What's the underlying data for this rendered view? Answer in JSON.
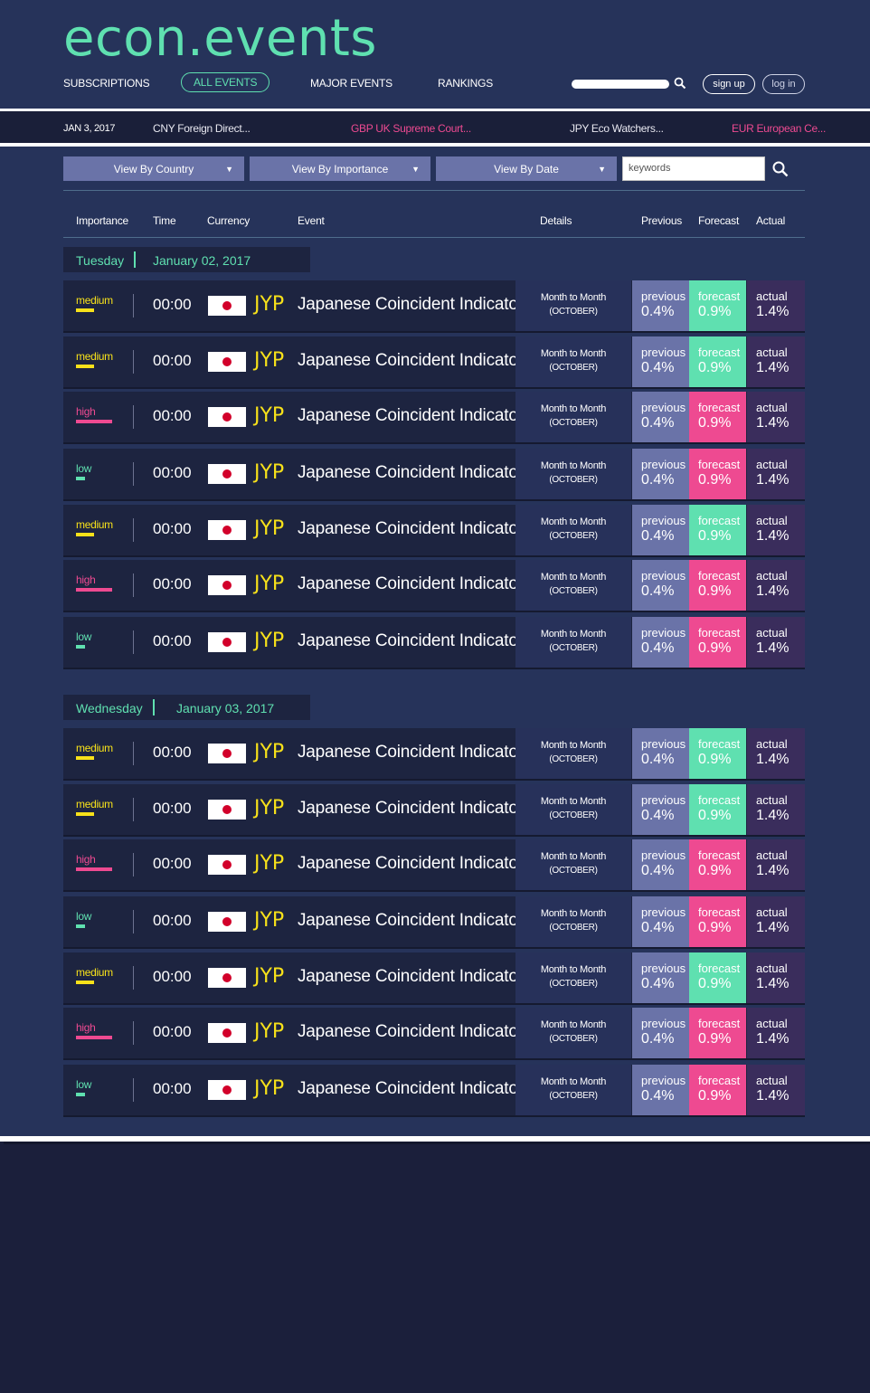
{
  "brand": {
    "logo": "econ.events"
  },
  "nav": {
    "items": [
      "SUBSCRIPTIONS",
      "ALL EVENTS",
      "MAJOR EVENTS",
      "RANKINGS"
    ],
    "active": "ALL EVENTS",
    "signup_label": "sign up",
    "login_label": "log in"
  },
  "ticker": {
    "date": "JAN 3, 2017",
    "items": [
      {
        "text": "CNY Foreign Direct...",
        "color": "#e8e8f0"
      },
      {
        "text": "GBP UK Supreme Court...",
        "color": "#ee4a91"
      },
      {
        "text": "JPY Eco Watchers...",
        "color": "#e8e8f0"
      },
      {
        "text": "EUR European Ce...",
        "color": "#ee4a91"
      }
    ]
  },
  "filters": {
    "country": "View By Country",
    "importance": "View By Importance",
    "date": "View By Date",
    "keywords_placeholder": "keywords"
  },
  "columns": [
    "Importance",
    "Time",
    "Currency",
    "Event",
    "Details",
    "Previous",
    "Forecast",
    "Actual"
  ],
  "colors": {
    "medium": "#f7e11a",
    "high": "#ee4a91",
    "low": "#5fe0b0",
    "forecast_green": "#5fe0b0",
    "forecast_pink": "#ee4a91"
  },
  "days": [
    {
      "day": "Tuesday",
      "date": "January 02, 2017",
      "rows": [
        {
          "importance": "medium",
          "time": "00:00",
          "currency": "JYP",
          "event": "Japanese Coincident Indicator",
          "detail1": "Month to Month",
          "detail2": "(OCTOBER)",
          "prev_label": "previous",
          "prev": "0.4%",
          "fc_label": "forecast",
          "fc": "0.9%",
          "fc_color": "green",
          "act_label": "actual",
          "act": "1.4%"
        },
        {
          "importance": "medium",
          "time": "00:00",
          "currency": "JYP",
          "event": "Japanese Coincident Indicator",
          "detail1": "Month to Month",
          "detail2": "(OCTOBER)",
          "prev_label": "previous",
          "prev": "0.4%",
          "fc_label": "forecast",
          "fc": "0.9%",
          "fc_color": "green",
          "act_label": "actual",
          "act": "1.4%"
        },
        {
          "importance": "high",
          "time": "00:00",
          "currency": "JYP",
          "event": "Japanese Coincident Indicator",
          "detail1": "Month to Month",
          "detail2": "(OCTOBER)",
          "prev_label": "previous",
          "prev": "0.4%",
          "fc_label": "forecast",
          "fc": "0.9%",
          "fc_color": "pink",
          "act_label": "actual",
          "act": "1.4%"
        },
        {
          "importance": "low",
          "time": "00:00",
          "currency": "JYP",
          "event": "Japanese Coincident Indicator",
          "detail1": "Month to Month",
          "detail2": "(OCTOBER)",
          "prev_label": "previous",
          "prev": "0.4%",
          "fc_label": "forecast",
          "fc": "0.9%",
          "fc_color": "pink",
          "act_label": "actual",
          "act": "1.4%"
        },
        {
          "importance": "medium",
          "time": "00:00",
          "currency": "JYP",
          "event": "Japanese Coincident Indicator",
          "detail1": "Month to Month",
          "detail2": "(OCTOBER)",
          "prev_label": "previous",
          "prev": "0.4%",
          "fc_label": "forecast",
          "fc": "0.9%",
          "fc_color": "green",
          "act_label": "actual",
          "act": "1.4%"
        },
        {
          "importance": "high",
          "time": "00:00",
          "currency": "JYP",
          "event": "Japanese Coincident Indicator",
          "detail1": "Month to Month",
          "detail2": "(OCTOBER)",
          "prev_label": "previous",
          "prev": "0.4%",
          "fc_label": "forecast",
          "fc": "0.9%",
          "fc_color": "pink",
          "act_label": "actual",
          "act": "1.4%"
        },
        {
          "importance": "low",
          "time": "00:00",
          "currency": "JYP",
          "event": "Japanese Coincident Indicator",
          "detail1": "Month to Month",
          "detail2": "(OCTOBER)",
          "prev_label": "previous",
          "prev": "0.4%",
          "fc_label": "forecast",
          "fc": "0.9%",
          "fc_color": "pink",
          "act_label": "actual",
          "act": "1.4%"
        }
      ]
    },
    {
      "day": "Wednesday",
      "date": "January 03, 2017",
      "rows": [
        {
          "importance": "medium",
          "time": "00:00",
          "currency": "JYP",
          "event": "Japanese Coincident Indicator",
          "detail1": "Month to Month",
          "detail2": "(OCTOBER)",
          "prev_label": "previous",
          "prev": "0.4%",
          "fc_label": "forecast",
          "fc": "0.9%",
          "fc_color": "green",
          "act_label": "actual",
          "act": "1.4%"
        },
        {
          "importance": "medium",
          "time": "00:00",
          "currency": "JYP",
          "event": "Japanese Coincident Indicator",
          "detail1": "Month to Month",
          "detail2": "(OCTOBER)",
          "prev_label": "previous",
          "prev": "0.4%",
          "fc_label": "forecast",
          "fc": "0.9%",
          "fc_color": "green",
          "act_label": "actual",
          "act": "1.4%"
        },
        {
          "importance": "high",
          "time": "00:00",
          "currency": "JYP",
          "event": "Japanese Coincident Indicator",
          "detail1": "Month to Month",
          "detail2": "(OCTOBER)",
          "prev_label": "previous",
          "prev": "0.4%",
          "fc_label": "forecast",
          "fc": "0.9%",
          "fc_color": "pink",
          "act_label": "actual",
          "act": "1.4%"
        },
        {
          "importance": "low",
          "time": "00:00",
          "currency": "JYP",
          "event": "Japanese Coincident Indicator",
          "detail1": "Month to Month",
          "detail2": "(OCTOBER)",
          "prev_label": "previous",
          "prev": "0.4%",
          "fc_label": "forecast",
          "fc": "0.9%",
          "fc_color": "pink",
          "act_label": "actual",
          "act": "1.4%"
        },
        {
          "importance": "medium",
          "time": "00:00",
          "currency": "JYP",
          "event": "Japanese Coincident Indicator",
          "detail1": "Month to Month",
          "detail2": "(OCTOBER)",
          "prev_label": "previous",
          "prev": "0.4%",
          "fc_label": "forecast",
          "fc": "0.9%",
          "fc_color": "green",
          "act_label": "actual",
          "act": "1.4%"
        },
        {
          "importance": "high",
          "time": "00:00",
          "currency": "JYP",
          "event": "Japanese Coincident Indicator",
          "detail1": "Month to Month",
          "detail2": "(OCTOBER)",
          "prev_label": "previous",
          "prev": "0.4%",
          "fc_label": "forecast",
          "fc": "0.9%",
          "fc_color": "pink",
          "act_label": "actual",
          "act": "1.4%"
        },
        {
          "importance": "low",
          "time": "00:00",
          "currency": "JYP",
          "event": "Japanese Coincident Indicator",
          "detail1": "Month to Month",
          "detail2": "(OCTOBER)",
          "prev_label": "previous",
          "prev": "0.4%",
          "fc_label": "forecast",
          "fc": "0.9%",
          "fc_color": "pink",
          "act_label": "actual",
          "act": "1.4%"
        }
      ]
    }
  ]
}
